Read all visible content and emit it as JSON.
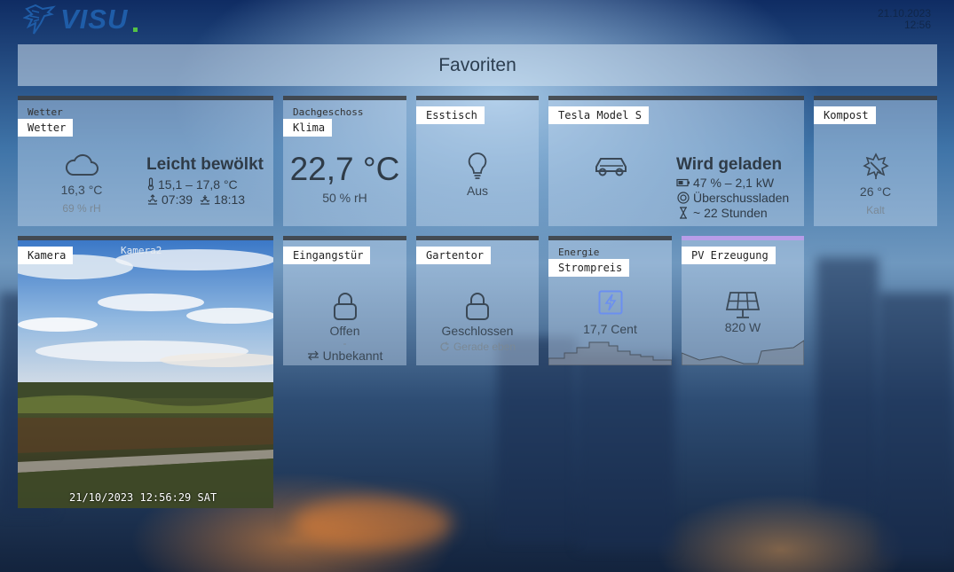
{
  "app": {
    "logo_text": "VISU"
  },
  "datetime": {
    "date": "21.10.2023",
    "time": "12:56"
  },
  "header": {
    "title": "Favoriten"
  },
  "tiles": {
    "wetter": {
      "group": "Wetter",
      "label": "Wetter",
      "icon": "cloud-icon",
      "temperature": "16,3 °C",
      "humidity": "69 % rH",
      "condition": "Leicht bewölkt",
      "range": "15,1 – 17,8 °C",
      "sunrise": "07:39",
      "sunset": "18:13"
    },
    "klima": {
      "group": "Dachgeschoss",
      "label": "Klima",
      "temperature": "22,7 °C",
      "humidity": "50 % rH"
    },
    "esstisch": {
      "label": "Esstisch",
      "icon": "lightbulb-icon",
      "state": "Aus"
    },
    "tesla": {
      "label": "Tesla Model S",
      "icon": "car-icon",
      "status": "Wird geladen",
      "battery": "47 % – 2,1 kW",
      "mode": "Überschussladen",
      "duration": "~ 22 Stunden"
    },
    "kompost": {
      "label": "Kompost",
      "icon": "leaf-icon",
      "temperature": "26 °C",
      "state": "Kalt"
    },
    "kamera": {
      "label": "Kamera",
      "overlay_title": "Kamera2",
      "timestamp": "21/10/2023 12:56:29 SAT"
    },
    "eingangstuer": {
      "label": "Eingangstür",
      "icon": "lock-open-icon",
      "state": "Offen",
      "sub": "-",
      "info": "Unbekannt"
    },
    "gartentor": {
      "label": "Gartentor",
      "icon": "lock-icon",
      "state": "Geschlossen",
      "info": "Gerade eben"
    },
    "strompreis": {
      "group": "Energie",
      "label": "Strompreis",
      "icon": "lightning-icon",
      "value": "17,7 Cent",
      "accent": "#6b8ff0"
    },
    "pv": {
      "label": "PV Erzeugung",
      "icon": "solar-panel-icon",
      "value": "820 W"
    }
  }
}
